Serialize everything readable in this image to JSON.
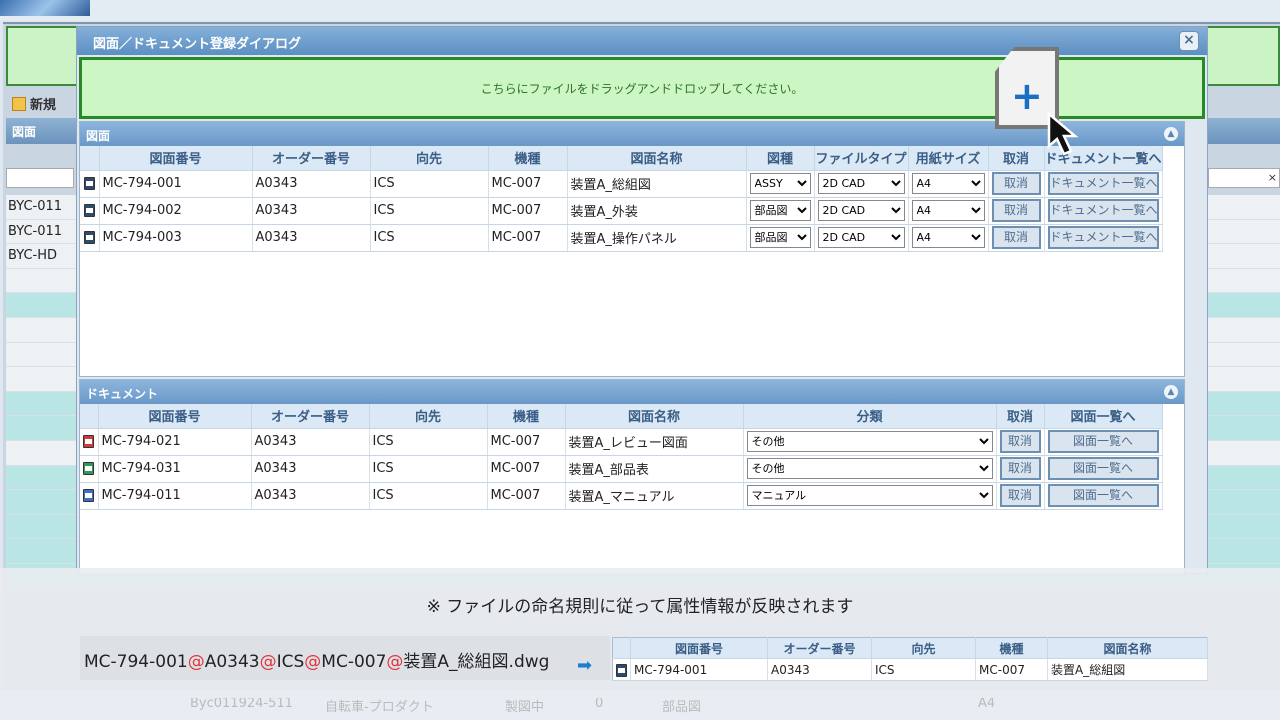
{
  "background": {
    "new_label": "新規",
    "section_label": "図面",
    "filter_clear": "×",
    "rows": [
      "BYC-011",
      "BYC-011",
      "BYC-HD",
      "",
      "",
      "",
      "",
      "",
      "",
      "",
      "",
      "",
      "",
      "",
      "",
      ""
    ],
    "bottom_row": [
      "Byc011924-511",
      "自転車-プロダクト",
      "製図中",
      "0",
      "部品図",
      "A4"
    ]
  },
  "dialog": {
    "title": "図面／ドキュメント登録ダイアログ",
    "close": "×",
    "dropzone_text": "こちらにファイルをドラッグアンドドロップしてください。"
  },
  "drawings": {
    "header": "図面",
    "columns": [
      "図面番号",
      "オーダー番号",
      "向先",
      "機種",
      "図面名称",
      "図種",
      "ファイルタイプ",
      "用紙サイズ",
      "取消",
      "ドキュメント一覧へ"
    ],
    "rows": [
      {
        "number": "MC-794-001",
        "order": "A0343",
        "dest": "ICS",
        "model": "MC-007",
        "name": "装置A_総組図",
        "type": "ASSY",
        "filetype": "2D CAD",
        "paper": "A4",
        "cancel": "取消",
        "link": "ドキュメント一覧へ"
      },
      {
        "number": "MC-794-002",
        "order": "A0343",
        "dest": "ICS",
        "model": "MC-007",
        "name": "装置A_外装",
        "type": "部品図",
        "filetype": "2D CAD",
        "paper": "A4",
        "cancel": "取消",
        "link": "ドキュメント一覧へ"
      },
      {
        "number": "MC-794-003",
        "order": "A0343",
        "dest": "ICS",
        "model": "MC-007",
        "name": "装置A_操作パネル",
        "type": "部品図",
        "filetype": "2D CAD",
        "paper": "A4",
        "cancel": "取消",
        "link": "ドキュメント一覧へ"
      }
    ]
  },
  "documents": {
    "header": "ドキュメント",
    "columns": [
      "図面番号",
      "オーダー番号",
      "向先",
      "機種",
      "図面名称",
      "分類",
      "取消",
      "図面一覧へ"
    ],
    "rows": [
      {
        "icon": "red",
        "number": "MC-794-021",
        "order": "A0343",
        "dest": "ICS",
        "model": "MC-007",
        "name": "装置A_レビュー図面",
        "category": "その他",
        "cancel": "取消",
        "link": "図面一覧へ"
      },
      {
        "icon": "green",
        "number": "MC-794-031",
        "order": "A0343",
        "dest": "ICS",
        "model": "MC-007",
        "name": "装置A_部品表",
        "category": "その他",
        "cancel": "取消",
        "link": "図面一覧へ"
      },
      {
        "icon": "blue",
        "number": "MC-794-011",
        "order": "A0343",
        "dest": "ICS",
        "model": "MC-007",
        "name": "装置A_マニュアル",
        "category": "マニュアル",
        "cancel": "取消",
        "link": "図面一覧へ"
      }
    ]
  },
  "overlay": {
    "note": "※ ファイルの命名規則に従って属性情報が反映されます",
    "filename_parts": [
      "MC-794-001",
      "@",
      "A0343",
      "@",
      "ICS",
      "@",
      "MC-007",
      "@",
      "装置A_総組図.dwg"
    ],
    "example_columns": [
      "図面番号",
      "オーダー番号",
      "向先",
      "機種",
      "図面名称"
    ],
    "example_row": [
      "MC-794-001",
      "A0343",
      "ICS",
      "MC-007",
      "装置A_総組図"
    ]
  },
  "colors": {
    "dropzone_border": "#278a27",
    "panel_header": "#6a98c7",
    "at_sign": "#e0353a",
    "arrow": "#1b7fd0"
  }
}
